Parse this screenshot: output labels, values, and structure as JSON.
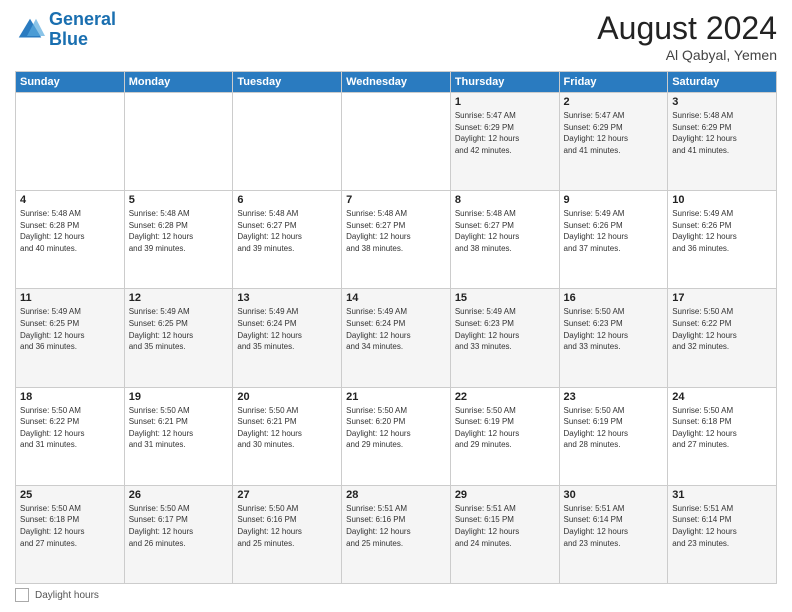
{
  "header": {
    "logo_line1": "General",
    "logo_line2": "Blue",
    "month_title": "August 2024",
    "location": "Al Qabyal, Yemen"
  },
  "footer": {
    "daylight_label": "Daylight hours"
  },
  "weekdays": [
    "Sunday",
    "Monday",
    "Tuesday",
    "Wednesday",
    "Thursday",
    "Friday",
    "Saturday"
  ],
  "weeks": [
    [
      {
        "day": "",
        "info": ""
      },
      {
        "day": "",
        "info": ""
      },
      {
        "day": "",
        "info": ""
      },
      {
        "day": "",
        "info": ""
      },
      {
        "day": "1",
        "info": "Sunrise: 5:47 AM\nSunset: 6:29 PM\nDaylight: 12 hours\nand 42 minutes."
      },
      {
        "day": "2",
        "info": "Sunrise: 5:47 AM\nSunset: 6:29 PM\nDaylight: 12 hours\nand 41 minutes."
      },
      {
        "day": "3",
        "info": "Sunrise: 5:48 AM\nSunset: 6:29 PM\nDaylight: 12 hours\nand 41 minutes."
      }
    ],
    [
      {
        "day": "4",
        "info": "Sunrise: 5:48 AM\nSunset: 6:28 PM\nDaylight: 12 hours\nand 40 minutes."
      },
      {
        "day": "5",
        "info": "Sunrise: 5:48 AM\nSunset: 6:28 PM\nDaylight: 12 hours\nand 39 minutes."
      },
      {
        "day": "6",
        "info": "Sunrise: 5:48 AM\nSunset: 6:27 PM\nDaylight: 12 hours\nand 39 minutes."
      },
      {
        "day": "7",
        "info": "Sunrise: 5:48 AM\nSunset: 6:27 PM\nDaylight: 12 hours\nand 38 minutes."
      },
      {
        "day": "8",
        "info": "Sunrise: 5:48 AM\nSunset: 6:27 PM\nDaylight: 12 hours\nand 38 minutes."
      },
      {
        "day": "9",
        "info": "Sunrise: 5:49 AM\nSunset: 6:26 PM\nDaylight: 12 hours\nand 37 minutes."
      },
      {
        "day": "10",
        "info": "Sunrise: 5:49 AM\nSunset: 6:26 PM\nDaylight: 12 hours\nand 36 minutes."
      }
    ],
    [
      {
        "day": "11",
        "info": "Sunrise: 5:49 AM\nSunset: 6:25 PM\nDaylight: 12 hours\nand 36 minutes."
      },
      {
        "day": "12",
        "info": "Sunrise: 5:49 AM\nSunset: 6:25 PM\nDaylight: 12 hours\nand 35 minutes."
      },
      {
        "day": "13",
        "info": "Sunrise: 5:49 AM\nSunset: 6:24 PM\nDaylight: 12 hours\nand 35 minutes."
      },
      {
        "day": "14",
        "info": "Sunrise: 5:49 AM\nSunset: 6:24 PM\nDaylight: 12 hours\nand 34 minutes."
      },
      {
        "day": "15",
        "info": "Sunrise: 5:49 AM\nSunset: 6:23 PM\nDaylight: 12 hours\nand 33 minutes."
      },
      {
        "day": "16",
        "info": "Sunrise: 5:50 AM\nSunset: 6:23 PM\nDaylight: 12 hours\nand 33 minutes."
      },
      {
        "day": "17",
        "info": "Sunrise: 5:50 AM\nSunset: 6:22 PM\nDaylight: 12 hours\nand 32 minutes."
      }
    ],
    [
      {
        "day": "18",
        "info": "Sunrise: 5:50 AM\nSunset: 6:22 PM\nDaylight: 12 hours\nand 31 minutes."
      },
      {
        "day": "19",
        "info": "Sunrise: 5:50 AM\nSunset: 6:21 PM\nDaylight: 12 hours\nand 31 minutes."
      },
      {
        "day": "20",
        "info": "Sunrise: 5:50 AM\nSunset: 6:21 PM\nDaylight: 12 hours\nand 30 minutes."
      },
      {
        "day": "21",
        "info": "Sunrise: 5:50 AM\nSunset: 6:20 PM\nDaylight: 12 hours\nand 29 minutes."
      },
      {
        "day": "22",
        "info": "Sunrise: 5:50 AM\nSunset: 6:19 PM\nDaylight: 12 hours\nand 29 minutes."
      },
      {
        "day": "23",
        "info": "Sunrise: 5:50 AM\nSunset: 6:19 PM\nDaylight: 12 hours\nand 28 minutes."
      },
      {
        "day": "24",
        "info": "Sunrise: 5:50 AM\nSunset: 6:18 PM\nDaylight: 12 hours\nand 27 minutes."
      }
    ],
    [
      {
        "day": "25",
        "info": "Sunrise: 5:50 AM\nSunset: 6:18 PM\nDaylight: 12 hours\nand 27 minutes."
      },
      {
        "day": "26",
        "info": "Sunrise: 5:50 AM\nSunset: 6:17 PM\nDaylight: 12 hours\nand 26 minutes."
      },
      {
        "day": "27",
        "info": "Sunrise: 5:50 AM\nSunset: 6:16 PM\nDaylight: 12 hours\nand 25 minutes."
      },
      {
        "day": "28",
        "info": "Sunrise: 5:51 AM\nSunset: 6:16 PM\nDaylight: 12 hours\nand 25 minutes."
      },
      {
        "day": "29",
        "info": "Sunrise: 5:51 AM\nSunset: 6:15 PM\nDaylight: 12 hours\nand 24 minutes."
      },
      {
        "day": "30",
        "info": "Sunrise: 5:51 AM\nSunset: 6:14 PM\nDaylight: 12 hours\nand 23 minutes."
      },
      {
        "day": "31",
        "info": "Sunrise: 5:51 AM\nSunset: 6:14 PM\nDaylight: 12 hours\nand 23 minutes."
      }
    ]
  ]
}
